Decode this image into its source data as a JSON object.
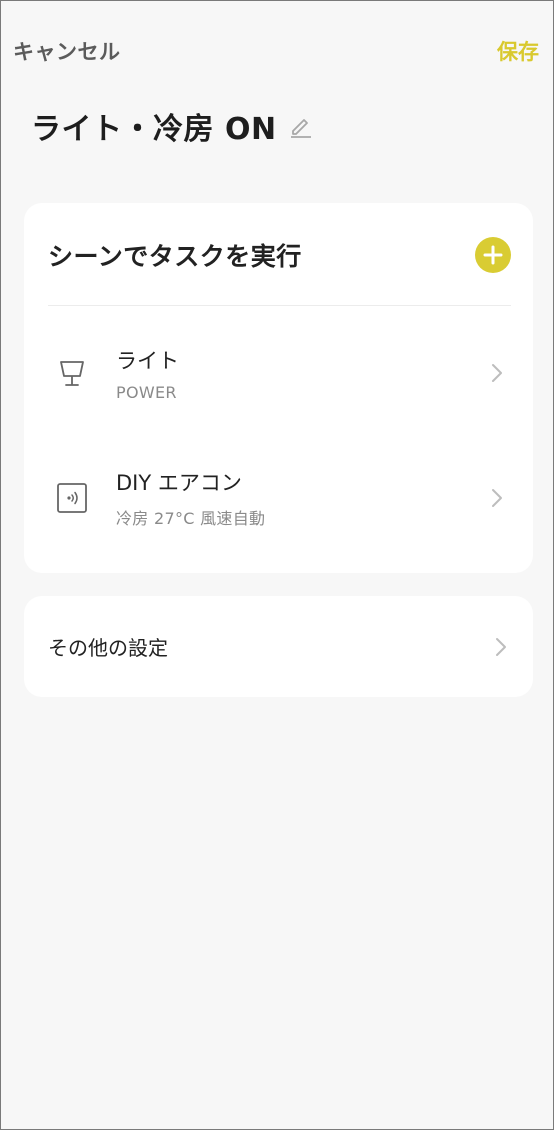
{
  "header": {
    "cancel_label": "キャンセル",
    "save_label": "保存"
  },
  "scene": {
    "title": "ライト・冷房 ON"
  },
  "tasks_card": {
    "title": "シーンでタスクを実行",
    "items": [
      {
        "name": "ライト",
        "detail": "POWER",
        "icon": "lamp-icon"
      },
      {
        "name": "DIY エアコン",
        "detail": "冷房 27°C 風速自動",
        "icon": "ir-remote-icon"
      }
    ]
  },
  "other_settings": {
    "label": "その他の設定"
  },
  "colors": {
    "accent": "#d9cc33",
    "background": "#f7f7f7",
    "card": "#ffffff"
  }
}
